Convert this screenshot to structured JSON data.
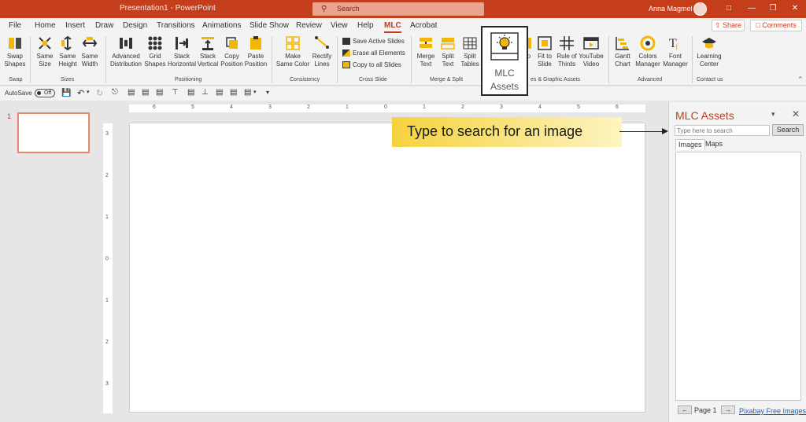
{
  "titlebar": {
    "title": "Presentation1 - PowerPoint",
    "search_placeholder": "Search",
    "user": "Anna Magmel",
    "color": "#c43e1c"
  },
  "tabs": [
    "File",
    "Home",
    "Insert",
    "Draw",
    "Design",
    "Transitions",
    "Animations",
    "Slide Show",
    "Review",
    "View",
    "Help",
    "MLC",
    "Acrobat"
  ],
  "active_tab": "MLC",
  "share_label": "Share",
  "comments_label": "Comments",
  "ribbon": {
    "swap": {
      "btn": [
        "Swap",
        "Shapes"
      ],
      "group": "Swap"
    },
    "sizes": {
      "btns": [
        [
          "Same",
          "Size"
        ],
        [
          "Same",
          "Height"
        ],
        [
          "Same",
          "Width"
        ]
      ],
      "group": "Sizes"
    },
    "positioning": {
      "btns": [
        [
          "Advanced",
          "Distribution"
        ],
        [
          "Grid",
          "Shapes"
        ],
        [
          "Stack",
          "Horizontal"
        ],
        [
          "Stack",
          "Vertical"
        ],
        [
          "Copy",
          "Position"
        ],
        [
          "Paste",
          "Position"
        ]
      ],
      "group": "Positioning"
    },
    "consistency": {
      "btns": [
        [
          "Make",
          "Same Color"
        ],
        [
          "Rectify",
          "Lines"
        ]
      ],
      "group": "Consistency"
    },
    "cross_slide": {
      "items": [
        "Save Active Slides",
        "Erase all Elements",
        "Copy to all Slides"
      ],
      "group": "Cross Slide"
    },
    "merge_split": {
      "btns": [
        [
          "Merge",
          "Text"
        ],
        [
          "Split",
          "Text"
        ],
        [
          "Split",
          "Tables"
        ]
      ],
      "group": "Merge & Split"
    },
    "mlc_assets": {
      "line1": "MLC",
      "line2": "Assets"
    },
    "shapes_graphic": {
      "btns": [
        [
          "o",
          ""
        ],
        [
          "Fit to",
          "Slide"
        ],
        [
          "Rule of",
          "Thirds"
        ],
        [
          "YouTube",
          "Video"
        ]
      ],
      "group": "es & Graphic Assets"
    },
    "advanced": {
      "btns": [
        [
          "Gantt",
          "Chart"
        ],
        [
          "Colors",
          "Manager"
        ],
        [
          "Font",
          "Manager"
        ]
      ],
      "group": "Advanced"
    },
    "contact": {
      "btn": [
        "Learning",
        "Center"
      ],
      "group": "Contact us"
    }
  },
  "qat": {
    "autosave": "AutoSave",
    "toggle": "Off"
  },
  "slide_number": "1",
  "ruler": {
    "h_labels": [
      "6",
      "5",
      "4",
      "3",
      "2",
      "1",
      "0",
      "1",
      "2",
      "3",
      "4",
      "5",
      "6"
    ],
    "v_labels": [
      "3",
      "2",
      "1",
      "0",
      "1",
      "2",
      "3"
    ]
  },
  "callout": "Type to search for an image",
  "pane": {
    "title": "MLC Assets",
    "search_placeholder": "Type here to search",
    "search_button": "Search",
    "tabs": [
      "Images",
      "Maps"
    ],
    "page": "Page 1",
    "link": "Pixabay Free Images"
  }
}
